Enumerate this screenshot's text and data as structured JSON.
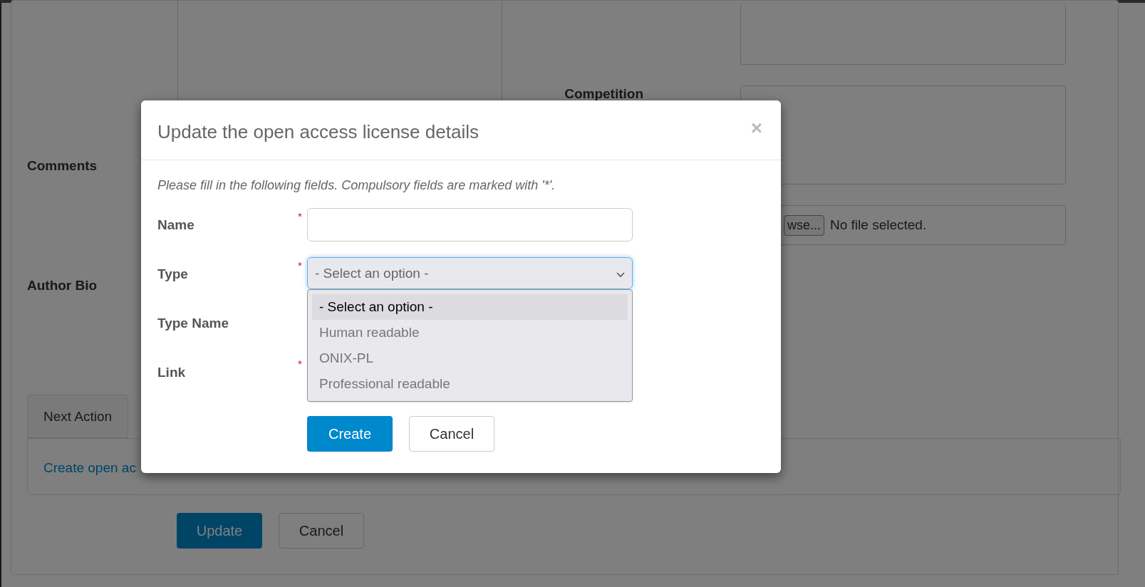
{
  "page": {
    "labels": [
      {
        "label": "Comments"
      },
      {
        "label": "Competition"
      },
      {
        "label": "Author Bio"
      }
    ],
    "file_button": "wse...",
    "file_status": "No file selected.",
    "tabs": [
      {
        "label": "Next Action",
        "selected": true
      }
    ],
    "tab_link": "Create open ac",
    "buttons": [
      {
        "label": "Update",
        "kind": "primary"
      },
      {
        "label": "Cancel",
        "kind": "default"
      }
    ]
  },
  "modal": {
    "title": "Update the open access license details",
    "close": "×",
    "required_mark": "*",
    "instructions": "Please fill in the following fields. Compulsory fields are marked with '*'.",
    "fields": [
      {
        "label": "Name",
        "required": true,
        "kind": "text"
      },
      {
        "label": "Type",
        "required": true,
        "kind": "select",
        "value": "- Select an option -",
        "expanded": true,
        "options": [
          {
            "label": "- Select an option -",
            "selected": true
          },
          {
            "label": "Human readable",
            "selected": false
          },
          {
            "label": "ONIX-PL",
            "selected": false
          },
          {
            "label": "Professional readable",
            "selected": false
          }
        ]
      },
      {
        "label": "Type Name",
        "required": false,
        "kind": "covered"
      },
      {
        "label": "Link",
        "required": true,
        "kind": "covered"
      }
    ],
    "buttons": [
      {
        "label": "Create",
        "kind": "primary"
      },
      {
        "label": "Cancel",
        "kind": "default"
      }
    ]
  }
}
